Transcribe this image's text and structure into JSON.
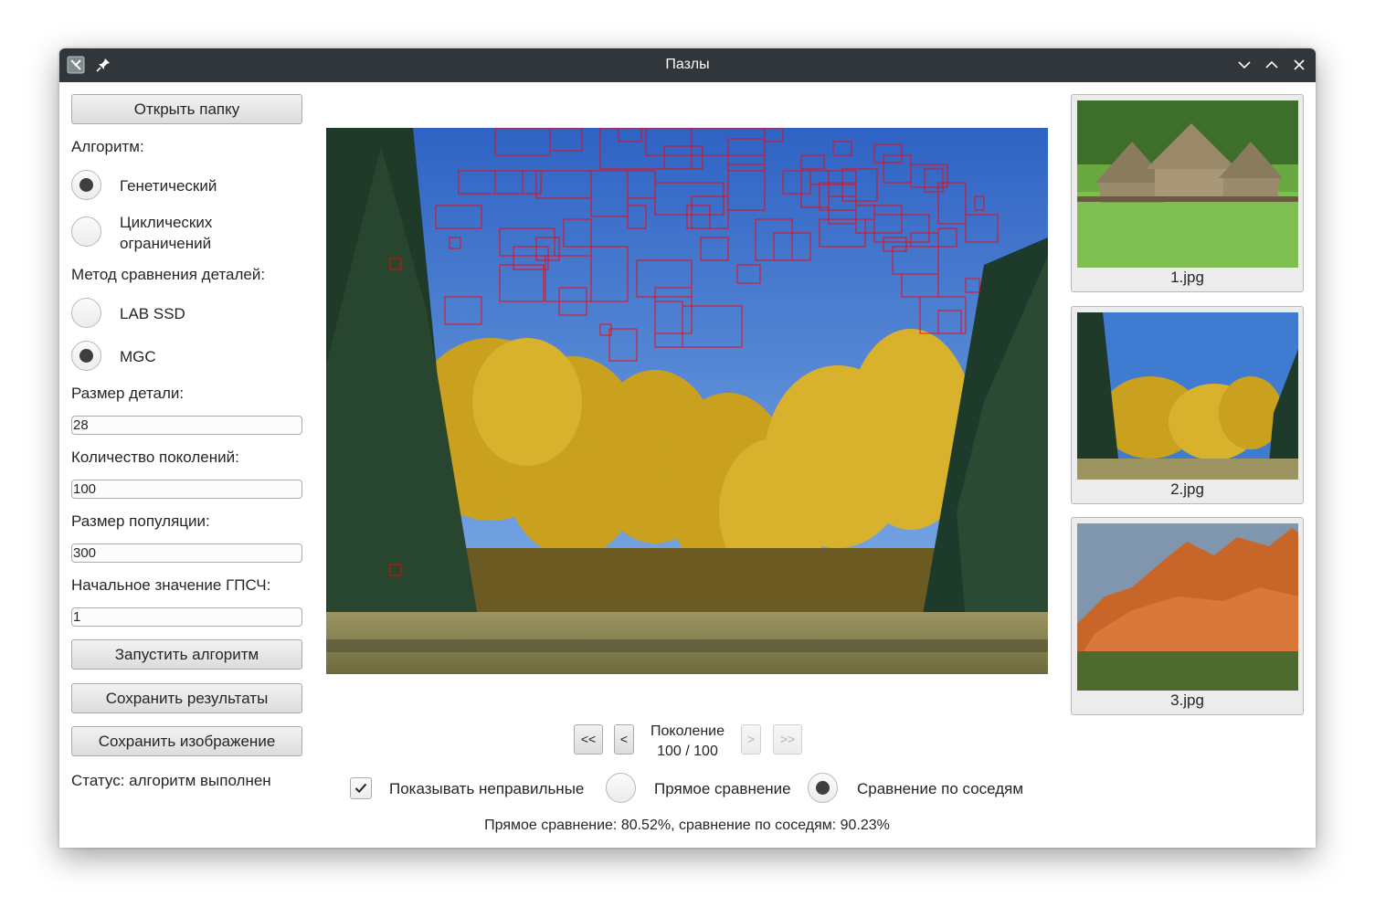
{
  "window": {
    "title": "Пазлы"
  },
  "sidebar": {
    "open_folder": "Открыть папку",
    "algorithm_label": "Алгоритм:",
    "algorithms": [
      {
        "label": "Генетический",
        "checked": true
      },
      {
        "label": "Циклических ограничений",
        "checked": false
      }
    ],
    "method_label": "Метод сравнения деталей:",
    "methods": [
      {
        "label": "LAB SSD",
        "checked": false
      },
      {
        "label": "MGC",
        "checked": true
      }
    ],
    "piece_size_label": "Размер детали:",
    "piece_size": "28",
    "generations_label": "Количество поколений:",
    "generations": "100",
    "population_label": "Размер популяции:",
    "population": "300",
    "seed_label": "Начальное значение ГПСЧ:",
    "seed": "1",
    "run": "Запустить алгоритм",
    "save_results": "Сохранить результаты",
    "save_image": "Сохранить изображение",
    "status": "Статус: алгоритм выполнен"
  },
  "nav": {
    "first": "<<",
    "prev": "<",
    "next": ">",
    "last": ">>",
    "generation_label": "Поколение",
    "generation_value": "100 / 100"
  },
  "options": {
    "show_wrong": {
      "label": "Показывать неправильные",
      "checked": true
    },
    "direct": {
      "label": "Прямое сравнение",
      "checked": false
    },
    "neighbors": {
      "label": "Сравнение по соседям",
      "checked": true
    }
  },
  "stats": "Прямое сравнение: 80.52%, сравнение по соседям: 90.23%",
  "thumbnails": [
    {
      "caption": "1.jpg"
    },
    {
      "caption": "2.jpg"
    },
    {
      "caption": "3.jpg"
    }
  ],
  "colors": {
    "titlebar": "#31363b",
    "wrong_piece_outline": "#ff0000"
  },
  "icons": [
    "app-icon",
    "pin-icon",
    "minimize-icon",
    "maximize-icon",
    "close-icon",
    "checkmark-icon"
  ]
}
